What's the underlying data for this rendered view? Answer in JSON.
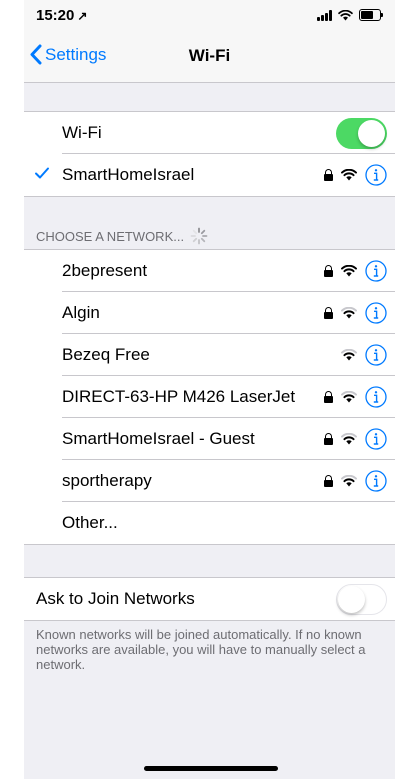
{
  "status": {
    "time": "15:20",
    "location_glyph": "↗"
  },
  "nav": {
    "back_label": "Settings",
    "title": "Wi-Fi"
  },
  "wifi_toggle": {
    "label": "Wi-Fi",
    "state": "on"
  },
  "connected": {
    "name": "SmartHomeIsrael",
    "secured": true
  },
  "section_header": "CHOOSE A NETWORK...",
  "networks": [
    {
      "name": "2bepresent",
      "secured": true
    },
    {
      "name": "Algin",
      "secured": true
    },
    {
      "name": "Bezeq Free",
      "secured": false
    },
    {
      "name": "DIRECT-63-HP M426 LaserJet",
      "secured": true
    },
    {
      "name": "SmartHomeIsrael - Guest",
      "secured": true
    },
    {
      "name": "sportherapy",
      "secured": true
    }
  ],
  "other_label": "Other...",
  "ask_to_join": {
    "label": "Ask to Join Networks",
    "state": "off"
  },
  "footer_text": "Known networks will be joined automatically. If no known networks are available, you will have to manually select a network.",
  "colors": {
    "accent": "#007aff",
    "toggle_on": "#4cd964",
    "background": "#efeff4"
  }
}
